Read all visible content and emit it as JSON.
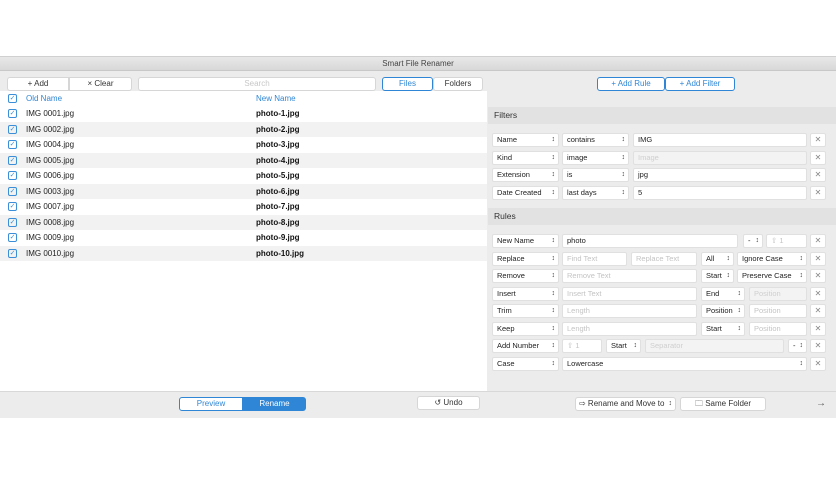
{
  "window": {
    "title": "Smart File Renamer"
  },
  "toolbar": {
    "add": "+ Add",
    "clear": "× Clear",
    "search_placeholder": "Search",
    "tab_files": "Files",
    "tab_folders": "Folders",
    "add_rule": "+ Add Rule",
    "add_filter": "+ Add Filter"
  },
  "list": {
    "col_old": "Old Name",
    "col_new": "New Name",
    "rows": [
      {
        "old": "IMG 0001.jpg",
        "new": "photo-1.jpg"
      },
      {
        "old": "IMG 0002.jpg",
        "new": "photo-2.jpg"
      },
      {
        "old": "IMG 0004.jpg",
        "new": "photo-3.jpg"
      },
      {
        "old": "IMG 0005.jpg",
        "new": "photo-4.jpg"
      },
      {
        "old": "IMG 0006.jpg",
        "new": "photo-5.jpg"
      },
      {
        "old": "IMG 0003.jpg",
        "new": "photo-6.jpg"
      },
      {
        "old": "IMG 0007.jpg",
        "new": "photo-7.jpg"
      },
      {
        "old": "IMG 0008.jpg",
        "new": "photo-8.jpg"
      },
      {
        "old": "IMG 0009.jpg",
        "new": "photo-9.jpg"
      },
      {
        "old": "IMG 0010.jpg",
        "new": "photo-10.jpg"
      }
    ]
  },
  "filters": {
    "title": "Filters",
    "rows": [
      {
        "field": "Name",
        "op": "contains",
        "value": "IMG",
        "ph": false
      },
      {
        "field": "Kind",
        "op": "image",
        "value": "Image",
        "ph": true
      },
      {
        "field": "Extension",
        "op": "is",
        "value": "jpg",
        "ph": false
      },
      {
        "field": "Date Created",
        "op": "last days",
        "value": "5",
        "ph": false
      }
    ]
  },
  "rules": {
    "title": "Rules",
    "new_name": {
      "type": "New Name",
      "value": "photo",
      "sep": "-",
      "num": "⇧ 1"
    },
    "replace": {
      "type": "Replace",
      "find": "Find Text",
      "repl": "Replace Text",
      "scope": "All",
      "case": "Ignore Case"
    },
    "remove": {
      "type": "Remove",
      "text": "Remove Text",
      "where": "Start",
      "case": "Preserve Case"
    },
    "insert": {
      "type": "Insert",
      "text": "Insert Text",
      "where": "End",
      "pos": "Position"
    },
    "trim": {
      "type": "Trim",
      "len": "Length",
      "where": "Position",
      "pos": "Position"
    },
    "keep": {
      "type": "Keep",
      "len": "Length",
      "where": "Start",
      "pos": "Position"
    },
    "add_number": {
      "type": "Add Number",
      "num": "⇧ 1",
      "where": "Start",
      "sep": "Separator",
      "dash": "-"
    },
    "case": {
      "type": "Case",
      "value": "Lowercase"
    }
  },
  "bottom": {
    "preview": "Preview",
    "rename": "Rename",
    "undo": "Undo",
    "move": "⇨ Rename and Move to",
    "folder": "Same Folder",
    "go": "→"
  },
  "colors": {
    "accent": "#2f86d6"
  }
}
